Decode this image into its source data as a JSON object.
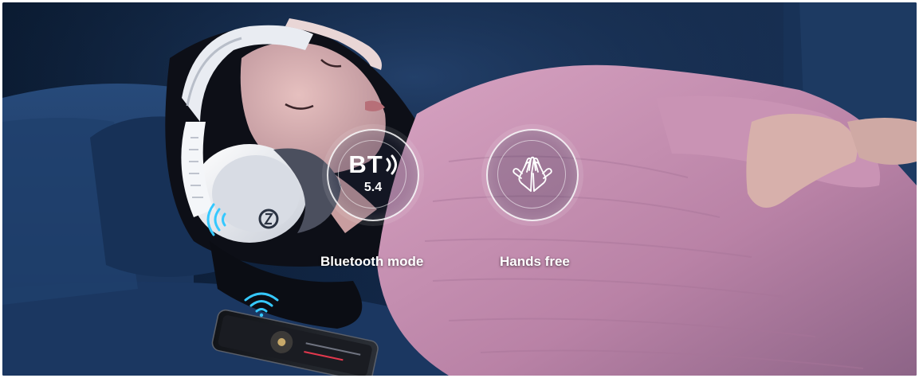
{
  "features": [
    {
      "name": "bluetooth",
      "badge_main": "BT",
      "badge_sub": "5.4",
      "label": "Bluetooth mode",
      "icon": "bluetooth-wave-icon"
    },
    {
      "name": "hands-free",
      "label": "Hands free",
      "icon": "hands-icon"
    }
  ],
  "phone": {
    "icon": "wifi-signal-icon"
  },
  "headset": {
    "icon": "signal-wave-icon"
  },
  "colors": {
    "background_dark": "#0e2038",
    "sofa_blue": "#1c3a63",
    "sweater_pink": "#c98fb0",
    "headset_white": "#eef0f4",
    "signal_cyan": "#35c8ff"
  }
}
